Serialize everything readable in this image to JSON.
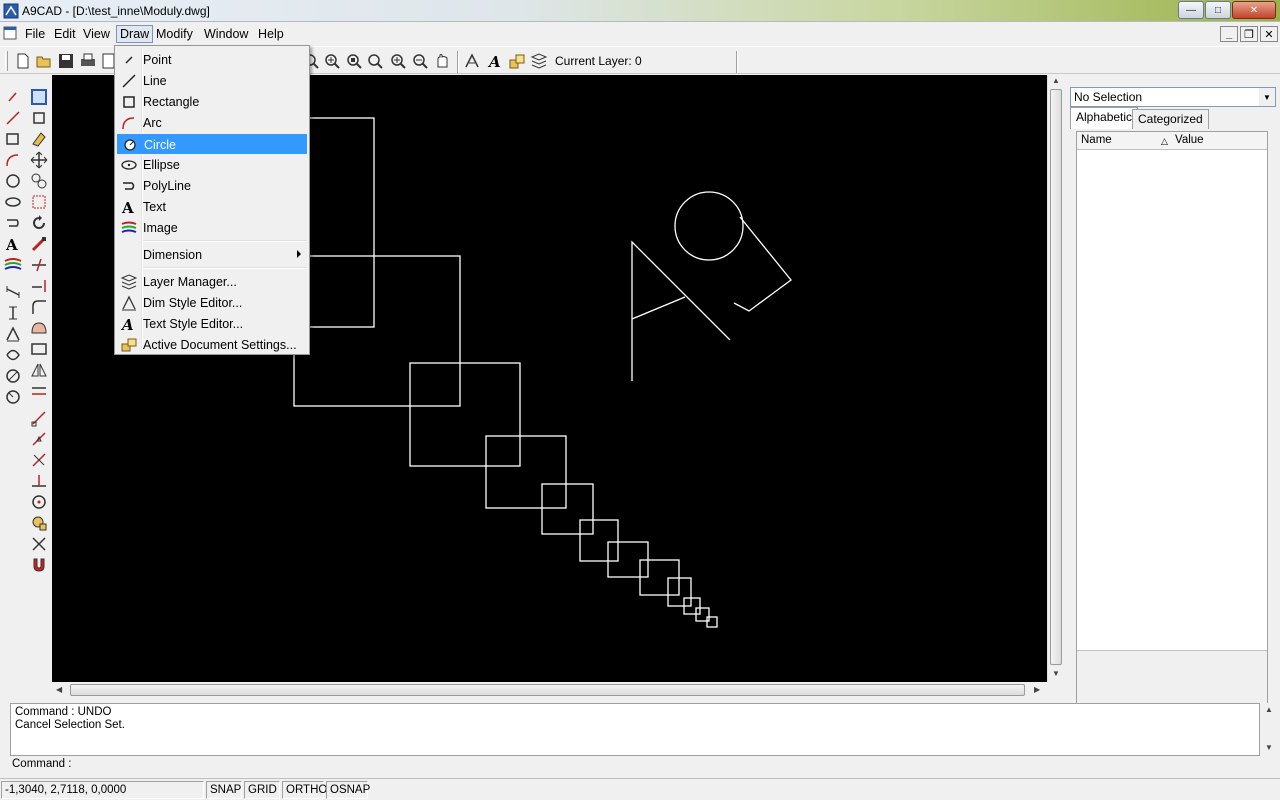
{
  "window": {
    "title": "A9CAD - [D:\\test_inne\\Moduly.dwg]"
  },
  "menubar": {
    "items": [
      "File",
      "Edit",
      "View",
      "Draw",
      "Modify",
      "Window",
      "Help"
    ]
  },
  "toolbar": {
    "current_layer_label": "Current Layer: 0"
  },
  "draw_menu": {
    "items": [
      {
        "label": "Point",
        "icon": "point-icon"
      },
      {
        "label": "Line",
        "icon": "line-icon"
      },
      {
        "label": "Rectangle",
        "icon": "rectangle-icon"
      },
      {
        "label": "Arc",
        "icon": "arc-icon"
      },
      {
        "label": "Circle",
        "icon": "circle-icon",
        "highlighted": true
      },
      {
        "label": "Ellipse",
        "icon": "ellipse-icon"
      },
      {
        "label": "PolyLine",
        "icon": "polyline-icon"
      },
      {
        "label": "Text",
        "icon": "text-icon"
      },
      {
        "label": "Image",
        "icon": "image-icon"
      },
      {
        "label": "Dimension",
        "icon": "",
        "submenu": true
      },
      {
        "label": "Layer Manager...",
        "icon": "layer-manager-icon"
      },
      {
        "label": "Dim Style Editor...",
        "icon": "dim-style-icon"
      },
      {
        "label": "Text Style Editor...",
        "icon": "text-style-icon"
      },
      {
        "label": "Active Document Settings...",
        "icon": "document-settings-icon"
      }
    ]
  },
  "properties": {
    "selection": "No Selection",
    "tabs": [
      "Alphabetic",
      "Categorized"
    ],
    "columns": [
      "Name",
      "Value"
    ]
  },
  "command": {
    "history": [
      "Command : UNDO",
      "Cancel Selection Set."
    ],
    "prompt": "Command :"
  },
  "statusbar": {
    "coords": "-1,3040, 2,7118, 0,0000",
    "toggles": [
      "SNAP",
      "GRID",
      "ORTHO",
      "OSNAP"
    ]
  },
  "colors": {
    "canvas": "#000000",
    "highlight": "#3399ff",
    "drawing_lines": "#ffffff"
  }
}
